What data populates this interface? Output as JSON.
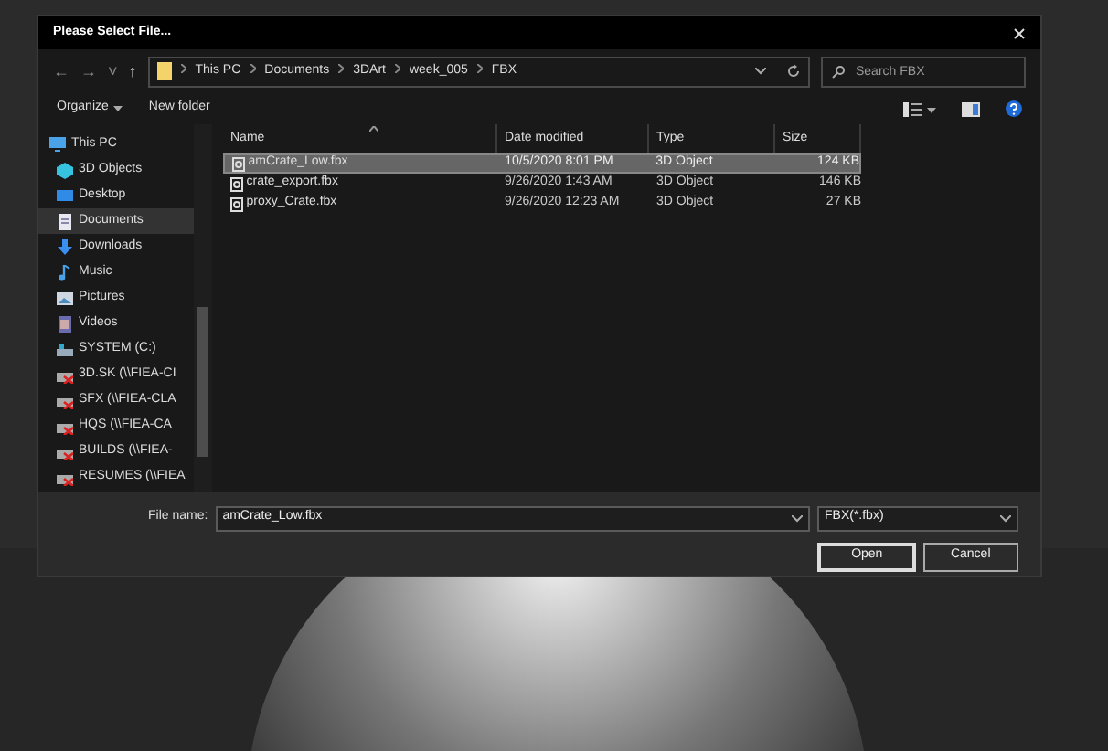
{
  "window": {
    "title": "Please Select File..."
  },
  "nav": {
    "back": "←",
    "forward": "→",
    "recent": "˅",
    "up": "↑"
  },
  "breadcrumb": [
    "This PC",
    "Documents",
    "3DArt",
    "week_005",
    "FBX"
  ],
  "search": {
    "placeholder": "Search FBX"
  },
  "toolbar": {
    "organize": "Organize",
    "new_folder": "New folder"
  },
  "sidebar": {
    "items": [
      {
        "label": "This PC",
        "kind": "pc",
        "selected": false,
        "children": [
          {
            "label": "3D Objects",
            "kind": "cube",
            "selected": false
          },
          {
            "label": "Desktop",
            "kind": "desktop",
            "selected": false
          },
          {
            "label": "Documents",
            "kind": "doc",
            "selected": true
          },
          {
            "label": "Downloads",
            "kind": "download",
            "selected": false
          },
          {
            "label": "Music",
            "kind": "music",
            "selected": false
          },
          {
            "label": "Pictures",
            "kind": "pictures",
            "selected": false
          },
          {
            "label": "Videos",
            "kind": "videos",
            "selected": false
          },
          {
            "label": "SYSTEM (C:)",
            "kind": "drive",
            "selected": false
          },
          {
            "label": "3D.SK (\\\\FIEA-CI",
            "kind": "netdrive",
            "selected": false
          },
          {
            "label": "SFX (\\\\FIEA-CLA",
            "kind": "netdrive",
            "selected": false
          },
          {
            "label": "HQS (\\\\FIEA-CA",
            "kind": "netdrive",
            "selected": false
          },
          {
            "label": "BUILDS (\\\\FIEA-",
            "kind": "netdrive",
            "selected": false
          },
          {
            "label": "RESUMES (\\\\FIEA",
            "kind": "netdrive",
            "selected": false
          }
        ]
      }
    ]
  },
  "table": {
    "columns": [
      "Name",
      "Date modified",
      "Type",
      "Size"
    ],
    "rows": [
      {
        "name": "amCrate_Low.fbx",
        "date": "10/5/2020 8:01 PM",
        "type": "3D Object",
        "size": "124 KB",
        "selected": true
      },
      {
        "name": "crate_export.fbx",
        "date": "9/26/2020 1:43 AM",
        "type": "3D Object",
        "size": "146 KB",
        "selected": false
      },
      {
        "name": "proxy_Crate.fbx",
        "date": "9/26/2020 12:23 AM",
        "type": "3D Object",
        "size": "27 KB",
        "selected": false
      }
    ]
  },
  "footer": {
    "file_name_label": "File name:",
    "file_name": "amCrate_Low.fbx",
    "filter": "FBX(*.fbx)",
    "open": "Open",
    "cancel": "Cancel"
  }
}
